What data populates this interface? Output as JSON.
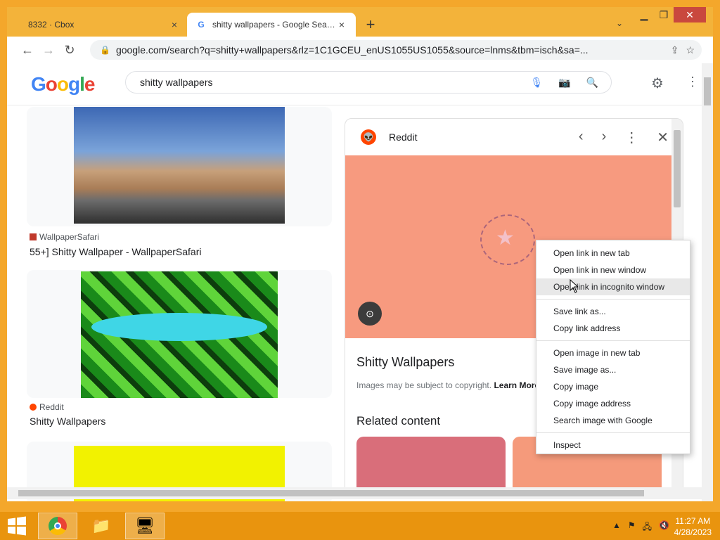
{
  "tabs": [
    {
      "title": "8332 · Cbox",
      "close": "×"
    },
    {
      "title": "shitty wallpapers - Google Search",
      "close": "×"
    }
  ],
  "new_tab": "+",
  "url": "google.com/search?q=shitty+wallpapers&rlz=1C1GCEU_enUS1055US1055&source=lnms&tbm=isch&sa=...",
  "search_query": "shitty wallpapers",
  "results": [
    {
      "source": "WallpaperSafari",
      "title": "55+] Shitty Wallpaper - WallpaperSafari"
    },
    {
      "source": "Reddit",
      "title": "Shitty Wallpapers"
    }
  ],
  "side_panel": {
    "source": "Reddit",
    "title": "Shitty Wallpapers",
    "copyright": "Images may be subject to copyright.",
    "learn_more": "Learn More",
    "related_heading": "Related content"
  },
  "context_menu": {
    "group1": [
      "Open link in new tab",
      "Open link in new window",
      "Open link in incognito window"
    ],
    "group2": [
      "Save link as...",
      "Copy link address"
    ],
    "group3": [
      "Open image in new tab",
      "Save image as...",
      "Copy image",
      "Copy image address",
      "Search image with Google"
    ],
    "group4": [
      "Inspect"
    ],
    "hovered": "Open link in incognito window"
  },
  "clock": {
    "time": "11:27 AM",
    "date": "4/28/2023"
  },
  "colors": {
    "accent": "#f3b33a",
    "taskbar": "#e9940e",
    "reddit": "#ff4500",
    "panel_image": "#f79a7f"
  }
}
